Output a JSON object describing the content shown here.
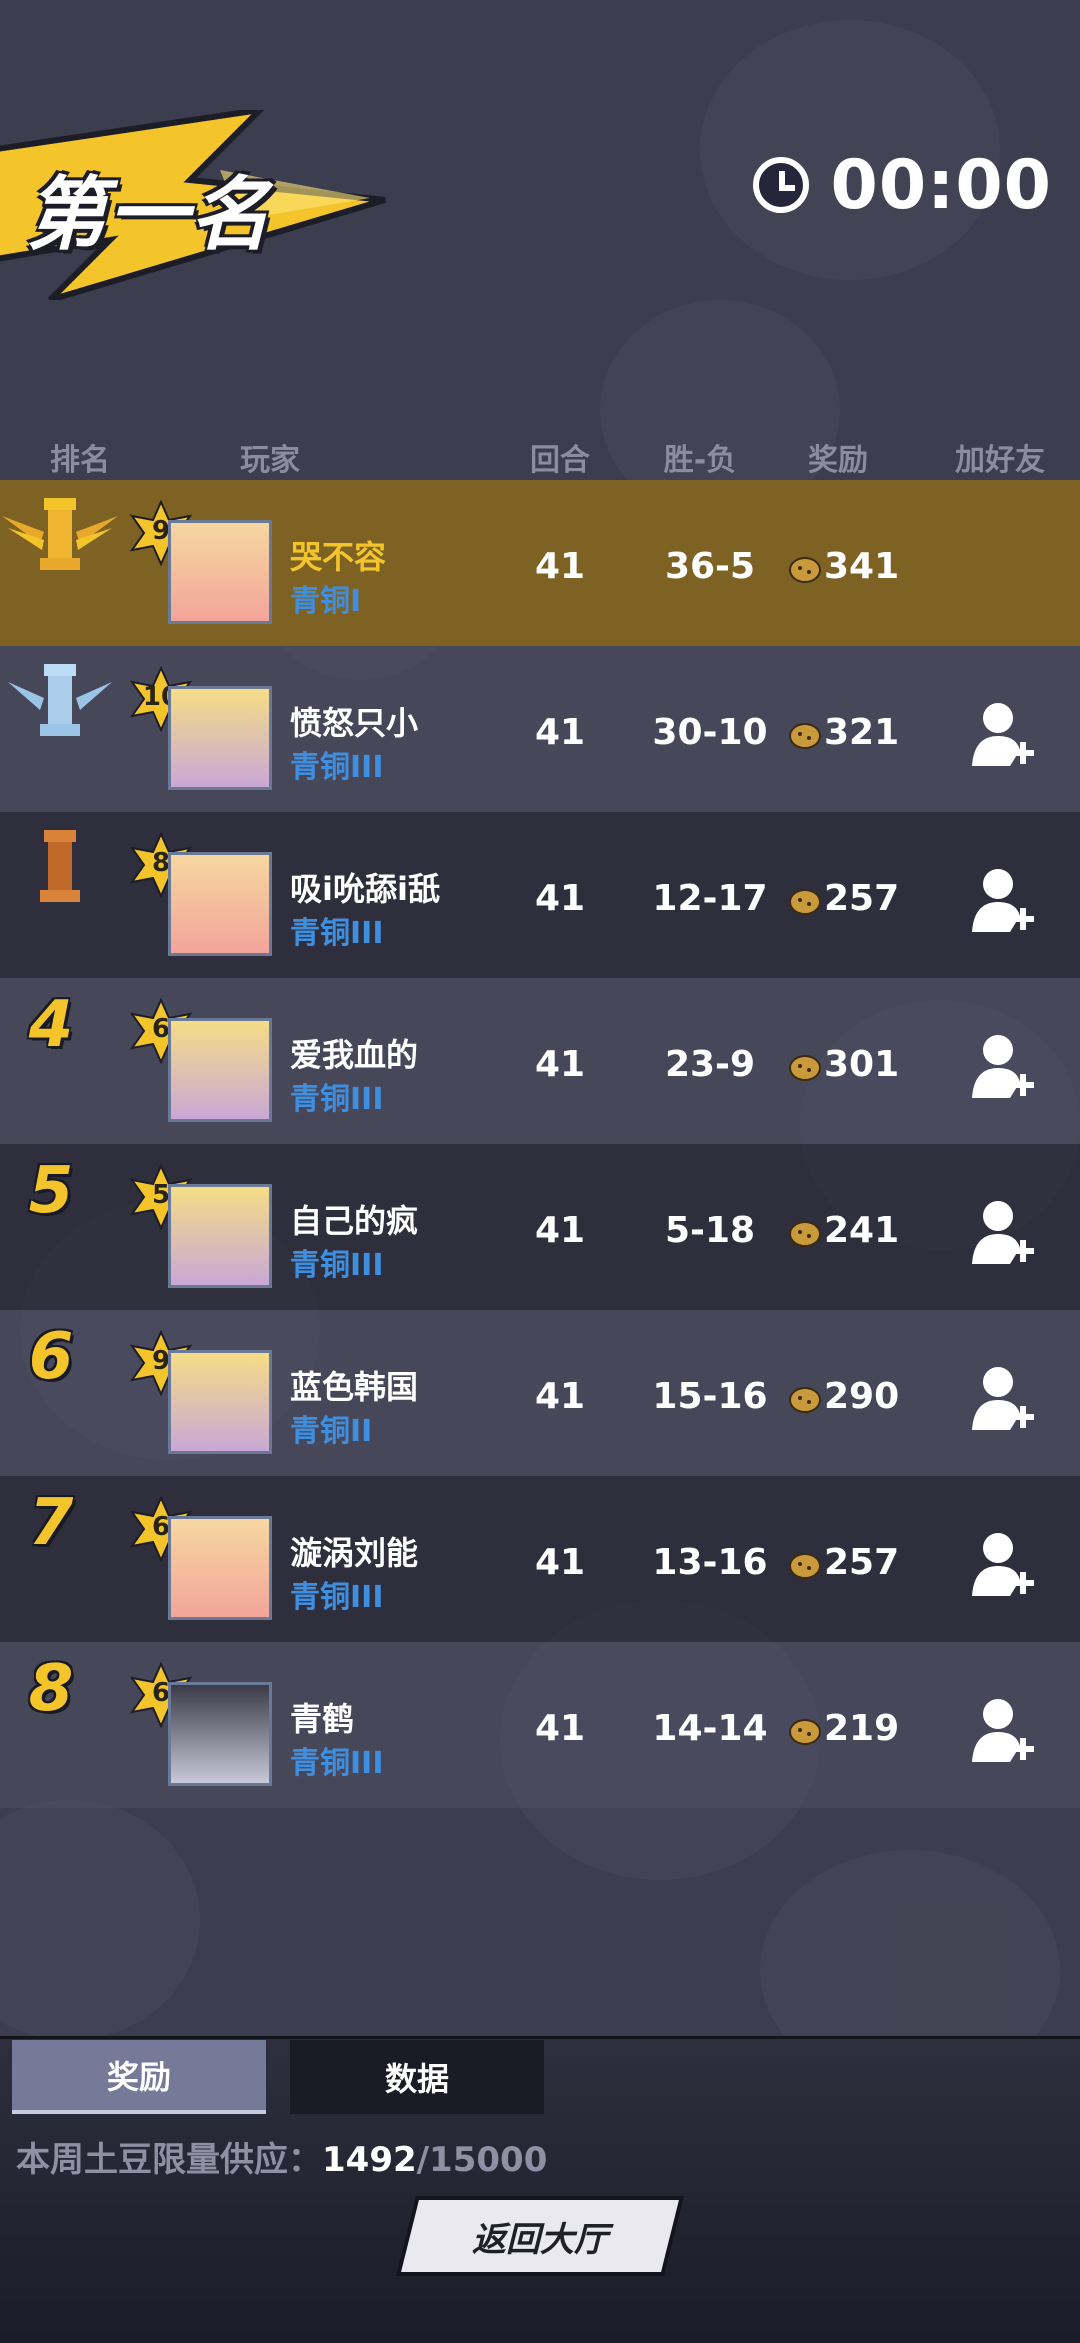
{
  "banner": {
    "title": "第一名"
  },
  "timer": {
    "value": "00:00",
    "icon": "clock-icon"
  },
  "headers": {
    "rank": "排名",
    "player": "玩家",
    "rounds": "回合",
    "win_loss": "胜-负",
    "reward": "奖励",
    "add_friend": "加好友"
  },
  "players": [
    {
      "rank": "1",
      "trophy": "gold",
      "level": "9",
      "name": "哭不容",
      "tier": "青铜I",
      "rounds": "41",
      "wl": "36-5",
      "reward": "341",
      "add_friend": false
    },
    {
      "rank": "2",
      "trophy": "silver",
      "level": "10",
      "name": "愤怒只小",
      "tier": "青铜III",
      "rounds": "41",
      "wl": "30-10",
      "reward": "321",
      "add_friend": true
    },
    {
      "rank": "3",
      "trophy": "bronze",
      "level": "8",
      "name": "吸i吮舔i舐",
      "tier": "青铜III",
      "rounds": "41",
      "wl": "12-17",
      "reward": "257",
      "add_friend": true
    },
    {
      "rank": "4",
      "level": "6",
      "name": "爱我血的",
      "tier": "青铜III",
      "rounds": "41",
      "wl": "23-9",
      "reward": "301",
      "add_friend": true
    },
    {
      "rank": "5",
      "level": "5",
      "name": "自己的疯",
      "tier": "青铜III",
      "rounds": "41",
      "wl": "5-18",
      "reward": "241",
      "add_friend": true
    },
    {
      "rank": "6",
      "level": "9",
      "name": "蓝色韩国",
      "tier": "青铜II",
      "rounds": "41",
      "wl": "15-16",
      "reward": "290",
      "add_friend": true
    },
    {
      "rank": "7",
      "level": "6",
      "name": "漩涡刘能",
      "tier": "青铜III",
      "rounds": "41",
      "wl": "13-16",
      "reward": "257",
      "add_friend": true
    },
    {
      "rank": "8",
      "level": "6",
      "name": "青鹤",
      "tier": "青铜III",
      "rounds": "41",
      "wl": "14-14",
      "reward": "219",
      "add_friend": true
    }
  ],
  "tabs": {
    "reward": "奖励",
    "data": "数据"
  },
  "supply": {
    "label": "本周土豆限量供应：",
    "current": "1492",
    "max": "/15000"
  },
  "back_button": "返回大厅",
  "colors": {
    "gold": "#f4c52a",
    "tier_blue": "#3f8fe0",
    "first_row": "#7e6223"
  }
}
